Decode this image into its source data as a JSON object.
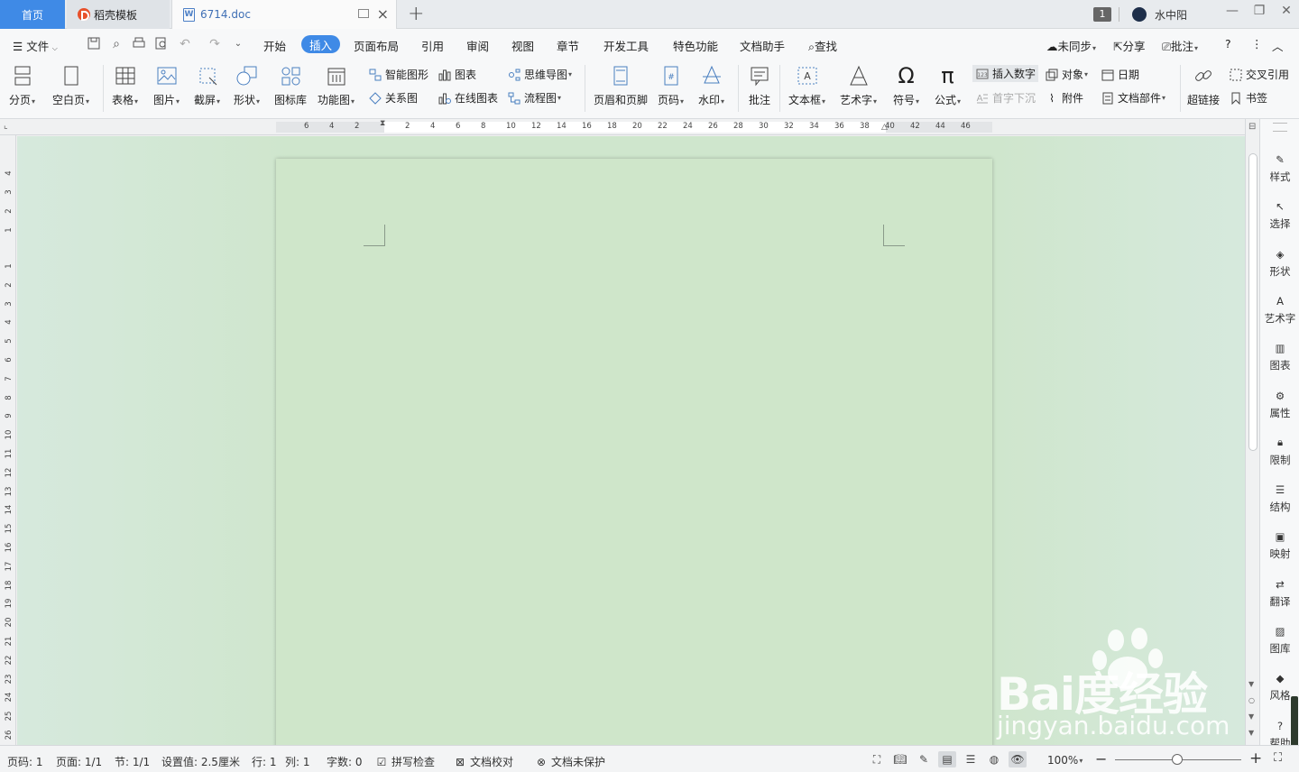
{
  "titlebar": {
    "home_tab": "首页",
    "template_tab": "稻壳模板",
    "doc_tab": "6714.doc",
    "new_tab": "+",
    "badge": "1",
    "username": "水中阳",
    "minimize": "—",
    "restore": "❐",
    "close": "✕"
  },
  "menu": {
    "file": "文件",
    "items": [
      "开始",
      "插入",
      "页面布局",
      "引用",
      "审阅",
      "视图",
      "章节",
      "开发工具",
      "特色功能",
      "文档助手"
    ],
    "active": "插入",
    "search": "查找",
    "sync": "未同步",
    "share": "分享",
    "comment": "批注"
  },
  "ribbon": {
    "page_break": "分页",
    "blank_page": "空白页",
    "table": "表格",
    "picture": "图片",
    "screenshot": "截屏",
    "shape": "形状",
    "icon_lib": "图标库",
    "function_chart": "功能图",
    "smart_art": "智能图形",
    "chart": "图表",
    "mind_map": "思维导图",
    "relation": "关系图",
    "online_chart": "在线图表",
    "flowchart": "流程图",
    "header_footer": "页眉和页脚",
    "page_number": "页码",
    "watermark": "水印",
    "annotation": "批注",
    "textbox": "文本框",
    "wordart": "艺术字",
    "symbol": "符号",
    "formula": "公式",
    "insert_number": "插入数字",
    "object": "对象",
    "date": "日期",
    "drop_cap": "首字下沉",
    "attachment": "附件",
    "doc_parts": "文档部件",
    "hyperlink": "超链接",
    "cross_ref": "交叉引用",
    "bookmark": "书签"
  },
  "ruler": {
    "h_ticks": [
      "6",
      "4",
      "2",
      "2",
      "4",
      "6",
      "8",
      "10",
      "12",
      "14",
      "16",
      "18",
      "20",
      "22",
      "24",
      "26",
      "28",
      "30",
      "32",
      "34",
      "36",
      "38",
      "40",
      "42",
      "44",
      "46"
    ],
    "v_ticks": [
      "4",
      "3",
      "2",
      "1",
      "1",
      "2",
      "3",
      "4",
      "5",
      "6",
      "7",
      "8",
      "9",
      "10",
      "11",
      "12",
      "13",
      "14",
      "15",
      "16",
      "17",
      "18",
      "19",
      "20",
      "21",
      "22",
      "23",
      "24",
      "25",
      "26"
    ]
  },
  "sidepanel": {
    "items": [
      "样式",
      "选择",
      "形状",
      "艺术字",
      "图表",
      "属性",
      "限制",
      "结构",
      "映射",
      "翻译",
      "图库",
      "风格",
      "帮助"
    ]
  },
  "status": {
    "page_num": "页码: 1",
    "pages": "页面: 1/1",
    "section": "节: 1/1",
    "setting": "设置值: 2.5厘米",
    "row": "行: 1",
    "col": "列: 1",
    "word_count": "字数: 0",
    "spell_check": "拼写检查",
    "doc_proof": "文档校对",
    "protect": "文档未保护",
    "zoom": "100%"
  },
  "watermark": {
    "logo": "Bai度经验",
    "url": "jingyan.baidu.com"
  },
  "colors": {
    "accent": "#3f8ae6",
    "page_bg": "#cfe6ca",
    "doc_bg": "#d6e9dd"
  }
}
